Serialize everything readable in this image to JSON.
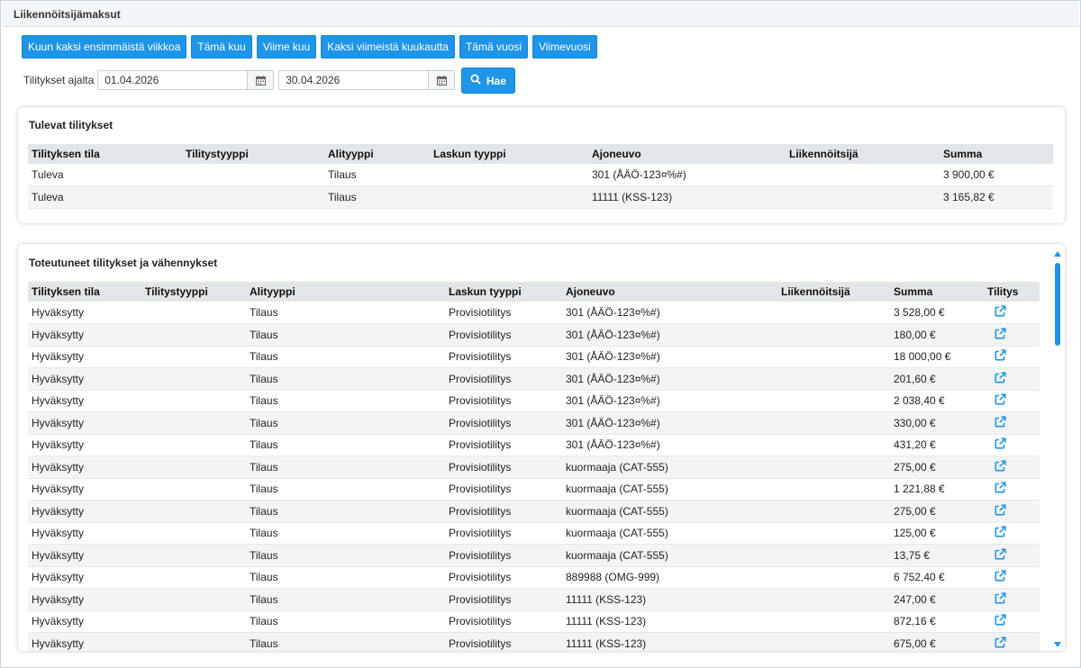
{
  "page": {
    "title": "Liikennöitsijämaksut"
  },
  "quick_buttons": [
    "Kuun kaksi ensimmäistä viikkoa",
    "Tämä kuu",
    "Viime kuu",
    "Kaksi viimeistä kuukautta",
    "Tämä vuosi",
    "Viimevuosi"
  ],
  "filter": {
    "label": "Tilitykset ajalta",
    "from": "01.04.2026",
    "to": "30.04.2026",
    "search_label": "Hae"
  },
  "upcoming": {
    "title": "Tulevat tilitykset",
    "headers": [
      "Tilityksen tila",
      "Tilitystyyppi",
      "Alityyppi",
      "Laskun tyyppi",
      "Ajoneuvo",
      "Liikennöitsijä",
      "Summa"
    ],
    "rows": [
      [
        "Tuleva",
        "",
        "Tilaus",
        "",
        "301 (ÅÄÖ-123¤%#)",
        "",
        "3 900,00 €"
      ],
      [
        "Tuleva",
        "",
        "Tilaus",
        "",
        "11111 (KSS-123)",
        "",
        "3 165,82 €"
      ]
    ]
  },
  "realized": {
    "title": "Toteutuneet tilitykset ja vähennykset",
    "headers": [
      "Tilityksen tila",
      "Tilitystyyppi",
      "Alityyppi",
      "Laskun tyyppi",
      "Ajoneuvo",
      "Liikennöitsijä",
      "Summa",
      "Tilitys"
    ],
    "rows": [
      [
        "Hyväksytty",
        "",
        "Tilaus",
        "Provisiotilitys",
        "301 (ÅÄÖ-123¤%#)",
        "",
        "3 528,00 €"
      ],
      [
        "Hyväksytty",
        "",
        "Tilaus",
        "Provisiotilitys",
        "301 (ÅÄÖ-123¤%#)",
        "",
        "180,00 €"
      ],
      [
        "Hyväksytty",
        "",
        "Tilaus",
        "Provisiotilitys",
        "301 (ÅÄÖ-123¤%#)",
        "",
        "18 000,00 €"
      ],
      [
        "Hyväksytty",
        "",
        "Tilaus",
        "Provisiotilitys",
        "301 (ÅÄÖ-123¤%#)",
        "",
        "201,60 €"
      ],
      [
        "Hyväksytty",
        "",
        "Tilaus",
        "Provisiotilitys",
        "301 (ÅÄÖ-123¤%#)",
        "",
        "2 038,40 €"
      ],
      [
        "Hyväksytty",
        "",
        "Tilaus",
        "Provisiotilitys",
        "301 (ÅÄÖ-123¤%#)",
        "",
        "330,00 €"
      ],
      [
        "Hyväksytty",
        "",
        "Tilaus",
        "Provisiotilitys",
        "301 (ÅÄÖ-123¤%#)",
        "",
        "431,20 €"
      ],
      [
        "Hyväksytty",
        "",
        "Tilaus",
        "Provisiotilitys",
        "kuormaaja (CAT-555)",
        "",
        "275,00 €"
      ],
      [
        "Hyväksytty",
        "",
        "Tilaus",
        "Provisiotilitys",
        "kuormaaja (CAT-555)",
        "",
        "1 221,88 €"
      ],
      [
        "Hyväksytty",
        "",
        "Tilaus",
        "Provisiotilitys",
        "kuormaaja (CAT-555)",
        "",
        "275,00 €"
      ],
      [
        "Hyväksytty",
        "",
        "Tilaus",
        "Provisiotilitys",
        "kuormaaja (CAT-555)",
        "",
        "125,00 €"
      ],
      [
        "Hyväksytty",
        "",
        "Tilaus",
        "Provisiotilitys",
        "kuormaaja (CAT-555)",
        "",
        "13,75 €"
      ],
      [
        "Hyväksytty",
        "",
        "Tilaus",
        "Provisiotilitys",
        "889988 (OMG-999)",
        "",
        "6 752,40 €"
      ],
      [
        "Hyväksytty",
        "",
        "Tilaus",
        "Provisiotilitys",
        "11111 (KSS-123)",
        "",
        "247,00 €"
      ],
      [
        "Hyväksytty",
        "",
        "Tilaus",
        "Provisiotilitys",
        "11111 (KSS-123)",
        "",
        "872,16 €"
      ],
      [
        "Hyväksytty",
        "",
        "Tilaus",
        "Provisiotilitys",
        "11111 (KSS-123)",
        "",
        "675,00 €"
      ]
    ],
    "row_icon": "external-link-icon"
  },
  "colors": {
    "accent": "#1e95e8",
    "header_bg": "#e3e6e9",
    "alt_row": "#f3f4f5"
  }
}
